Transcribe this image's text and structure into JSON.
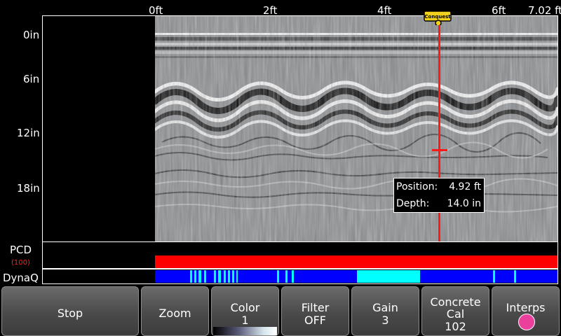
{
  "x_axis": {
    "ticks": [
      "0ft",
      "2ft",
      "4ft",
      "6ft",
      "7.02 ft"
    ]
  },
  "y_axis": {
    "ticks": [
      "0in",
      "6in",
      "12in",
      "18in"
    ]
  },
  "marker": {
    "label": "Conquest"
  },
  "readout": {
    "position_label": "Position:",
    "position_value": "4.92 ft",
    "depth_label": "Depth:",
    "depth_value": "14.0 in"
  },
  "pcd": {
    "label": "PCD",
    "sub_label": "(100)"
  },
  "dynaq": {
    "label": "DynaQ"
  },
  "toolbar": {
    "stop": "Stop",
    "zoom": "Zoom",
    "color_label": "Color",
    "color_value": "1",
    "filter_label": "Filter",
    "filter_value": "OFF",
    "gain_label": "Gain",
    "gain_value": "3",
    "cal_label1": "Concrete",
    "cal_label2": "Cal",
    "cal_value": "102",
    "interps": "Interps"
  },
  "colors": {
    "cursor": "#ff1a1a",
    "pcd_bar": "#ff0000",
    "dynaq_blue": "#0000ff",
    "dynaq_cyan": "#00ffff",
    "interps_indicator": "#ea3f9b"
  }
}
